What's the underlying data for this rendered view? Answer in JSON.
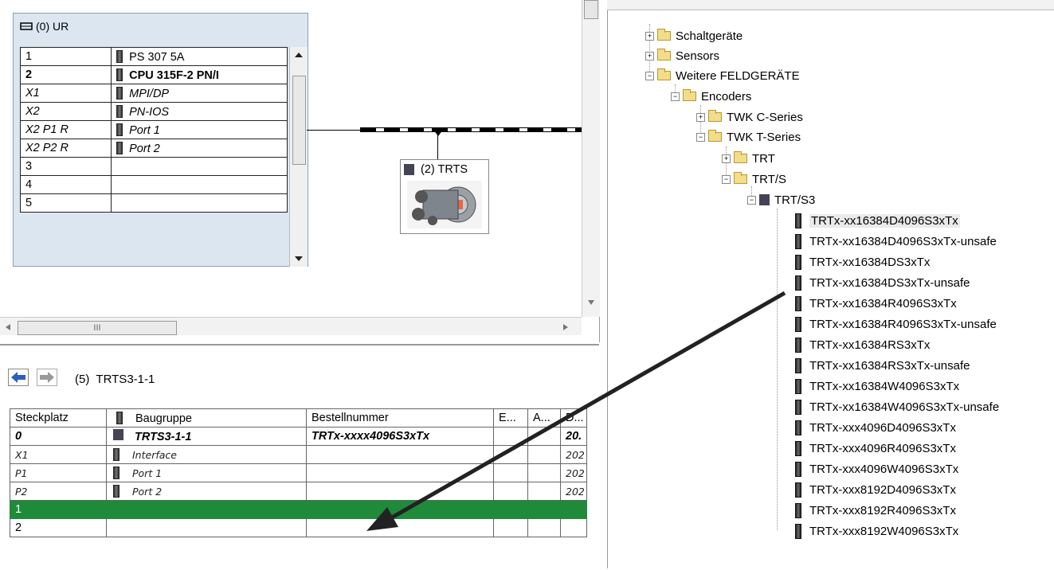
{
  "station": {
    "rack_title": "(0) UR",
    "rack_rows": [
      {
        "slot": "1",
        "module": "PS 307 5A",
        "style": "normal"
      },
      {
        "slot": "2",
        "module": "CPU 315F-2 PN/I",
        "style": "bold"
      },
      {
        "slot": "X1",
        "module": "MPI/DP",
        "style": "italic"
      },
      {
        "slot": "X2",
        "module": "PN-IOS",
        "style": "italic"
      },
      {
        "slot": "X2 P1 R",
        "module": "Port 1",
        "style": "italic"
      },
      {
        "slot": "X2 P2 R",
        "module": "Port 2",
        "style": "italic"
      },
      {
        "slot": "3",
        "module": "",
        "style": "normal"
      },
      {
        "slot": "4",
        "module": "",
        "style": "normal"
      },
      {
        "slot": "5",
        "module": "",
        "style": "normal"
      }
    ],
    "device_label": "(2) TRTS",
    "hscroll_grip": "III"
  },
  "detail": {
    "title_prefix": "(5)",
    "title": "TRTS3-1-1",
    "columns": [
      "Steckplatz",
      "Baugruppe",
      "Bestellnummer",
      "E...",
      "A...",
      "D..."
    ],
    "rows": [
      {
        "slot": "0",
        "module": "TRTS3-1-1",
        "order": "TRTx-xxxx4096S3xTx",
        "e": "",
        "a": "",
        "d": "20.",
        "style": "bold"
      },
      {
        "slot": "X1",
        "module": "Interface",
        "order": "",
        "e": "",
        "a": "",
        "d": "202",
        "style": "italic"
      },
      {
        "slot": "P1",
        "module": "Port 1",
        "order": "",
        "e": "",
        "a": "",
        "d": "202",
        "style": "italic"
      },
      {
        "slot": "P2",
        "module": "Port 2",
        "order": "",
        "e": "",
        "a": "",
        "d": "202",
        "style": "italic"
      },
      {
        "slot": "1",
        "module": "",
        "order": "",
        "e": "",
        "a": "",
        "d": "",
        "style": "selected"
      },
      {
        "slot": "2",
        "module": "",
        "order": "",
        "e": "",
        "a": "",
        "d": "",
        "style": "normal"
      }
    ]
  },
  "catalog": {
    "folders": [
      {
        "label": "Schaltgeräte",
        "expander": "+"
      },
      {
        "label": "Sensors",
        "expander": "+"
      },
      {
        "label": "Weitere FELDGERÄTE",
        "expander": "−"
      },
      {
        "label": "Encoders",
        "expander": "−"
      },
      {
        "label": "TWK C-Series",
        "expander": "+"
      },
      {
        "label": "TWK T-Series",
        "expander": "−"
      },
      {
        "label": "TRT",
        "expander": "+"
      },
      {
        "label": "TRT/S",
        "expander": "−"
      },
      {
        "label": "TRT/S3",
        "expander": "−"
      }
    ],
    "items": [
      "TRTx-xx16384D4096S3xTx",
      "TRTx-xx16384D4096S3xTx-unsafe",
      "TRTx-xx16384DS3xTx",
      "TRTx-xx16384DS3xTx-unsafe",
      "TRTx-xx16384R4096S3xTx",
      "TRTx-xx16384R4096S3xTx-unsafe",
      "TRTx-xx16384RS3xTx",
      "TRTx-xx16384RS3xTx-unsafe",
      "TRTx-xx16384W4096S3xTx",
      "TRTx-xx16384W4096S3xTx-unsafe",
      "TRTx-xxx4096D4096S3xTx",
      "TRTx-xxx4096R4096S3xTx",
      "TRTx-xxx4096W4096S3xTx",
      "TRTx-xxx8192D4096S3xTx",
      "TRTx-xxx8192R4096S3xTx",
      "TRTx-xxx8192W4096S3xTx"
    ]
  },
  "colors": {
    "selected_row": "#1e8a3a",
    "rack_bg": "#dbe6f1"
  }
}
